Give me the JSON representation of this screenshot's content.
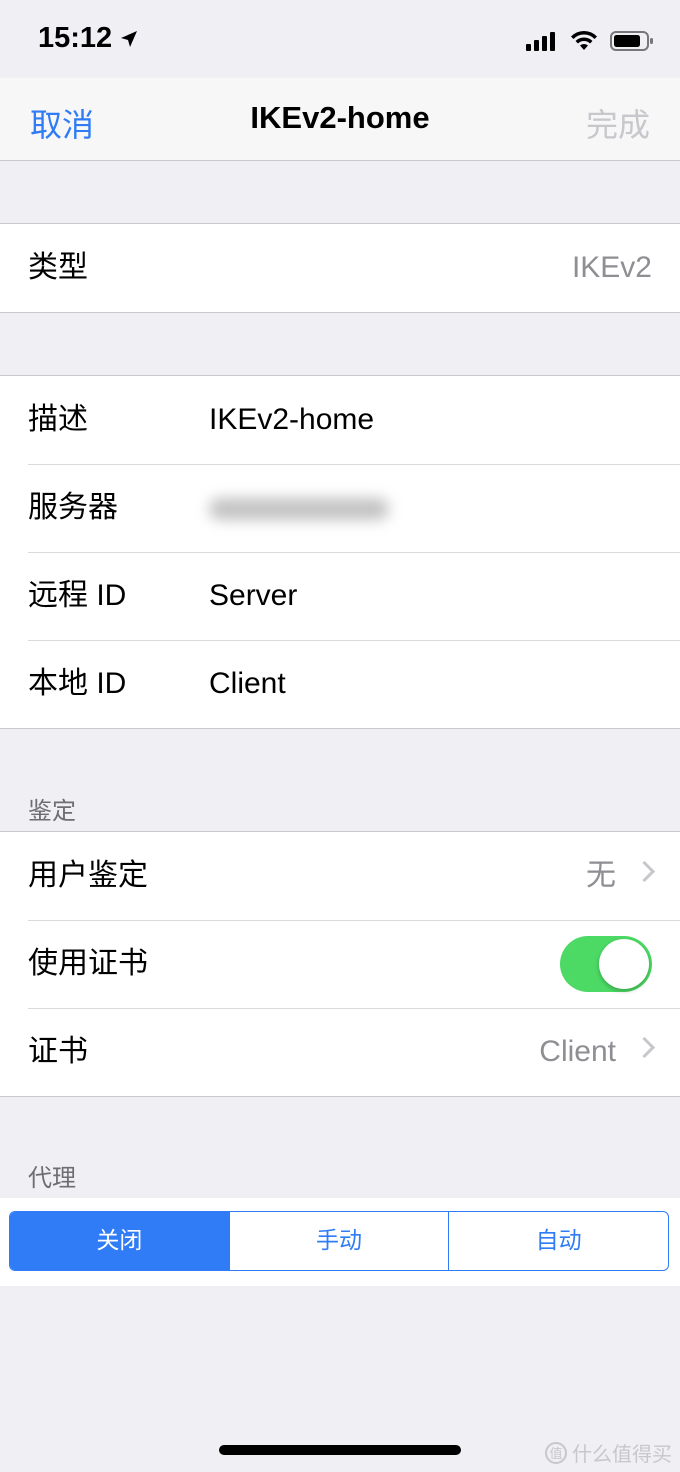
{
  "status_bar": {
    "time": "15:12"
  },
  "nav": {
    "cancel": "取消",
    "title": "IKEv2-home",
    "done": "完成"
  },
  "type_row": {
    "label": "类型",
    "value": "IKEv2"
  },
  "details": [
    {
      "label": "描述",
      "value": "IKEv2-home"
    },
    {
      "label": "服务器",
      "value": ""
    },
    {
      "label": "远程 ID",
      "value": "Server"
    },
    {
      "label": "本地 ID",
      "value": "Client"
    }
  ],
  "auth": {
    "header": "鉴定",
    "user_auth": {
      "label": "用户鉴定",
      "value": "无"
    },
    "use_cert": {
      "label": "使用证书",
      "on": true
    },
    "cert": {
      "label": "证书",
      "value": "Client"
    }
  },
  "proxy": {
    "header": "代理",
    "options": [
      "关闭",
      "手动",
      "自动"
    ],
    "selected": 0
  },
  "watermark": "什么值得买",
  "colors": {
    "accent": "#2f7cf6",
    "toggle_on": "#4cd964",
    "background": "#efeff4"
  }
}
